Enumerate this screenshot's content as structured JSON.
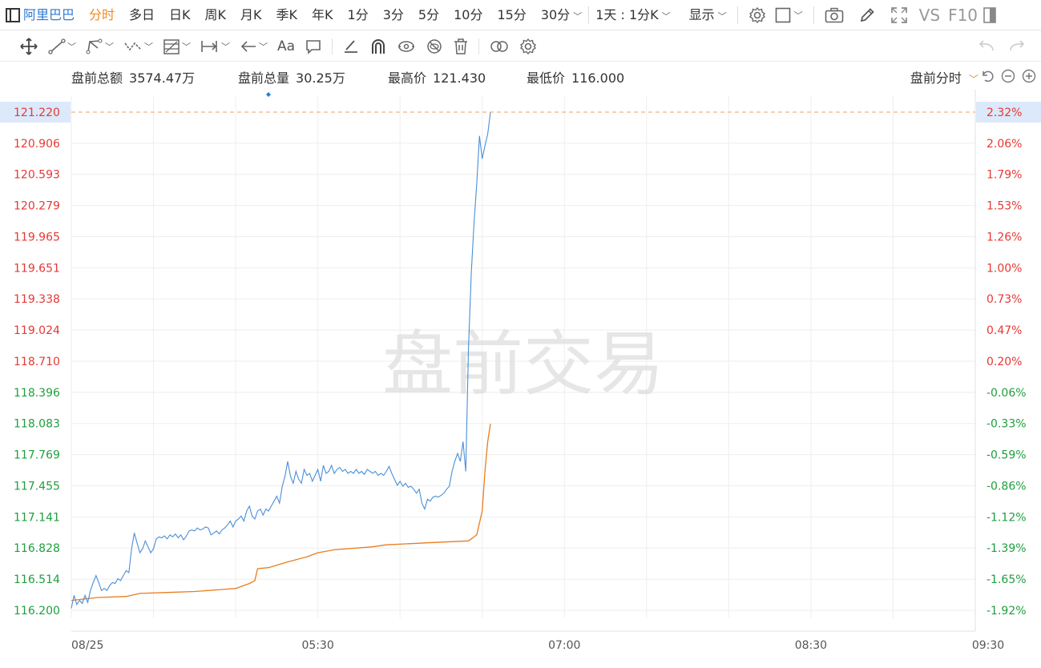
{
  "toolbar": {
    "title": "阿里巴巴",
    "periods": [
      {
        "label": "分时",
        "active": true
      },
      {
        "label": "多日",
        "active": false
      },
      {
        "label": "日K",
        "active": false
      },
      {
        "label": "周K",
        "active": false
      },
      {
        "label": "月K",
        "active": false
      },
      {
        "label": "季K",
        "active": false
      },
      {
        "label": "年K",
        "active": false
      },
      {
        "label": "1分",
        "active": false
      },
      {
        "label": "3分",
        "active": false
      },
      {
        "label": "5分",
        "active": false
      },
      {
        "label": "10分",
        "active": false
      },
      {
        "label": "15分",
        "active": false
      }
    ],
    "period_more": "30分",
    "period_ratio": "1天 : 1分K",
    "display": "显示",
    "vs": "VS",
    "f10": "F10",
    "icons": [
      "panel-toggle-icon",
      "settings-icon",
      "square-icon",
      "camera-icon",
      "pencil-icon",
      "fullscreen-icon"
    ]
  },
  "drawbar": {
    "text_tool": "Aa",
    "icons": [
      "move-icon",
      "line-icon",
      "polyline-icon",
      "wave-icon",
      "fib-icon",
      "measure-icon",
      "arrow-icon",
      "text-icon",
      "comment-icon",
      "eraser-line-icon",
      "magnet-icon",
      "eye-icon",
      "hide-icon",
      "trash-icon",
      "link-icon",
      "settings-icon",
      "undo-icon",
      "redo-icon"
    ]
  },
  "info": {
    "amount_label": "盘前总额",
    "amount_value": "3574.47万",
    "volume_label": "盘前总量",
    "volume_value": "30.25万",
    "high_label": "最高价",
    "high_value": "121.430",
    "low_label": "最低价",
    "low_value": "116.000",
    "mode_label": "盘前分时"
  },
  "colors": {
    "up": "#e53935",
    "down": "#1f9e3f",
    "price_line": "#4a8fd8",
    "avg_line": "#e87d1e",
    "grid": "#eeeeee",
    "highlight_bg": "#dbe9fb",
    "dashed": "#f0a060"
  },
  "chart_data": {
    "type": "line",
    "watermark": "盘前交易",
    "prev_close": 118.5,
    "ylim": [
      116.2,
      121.22
    ],
    "current_price": "121.220",
    "current_pct": "2.32%",
    "y_ticks": [
      121.22,
      120.906,
      120.593,
      120.279,
      119.965,
      119.651,
      119.338,
      119.024,
      118.71,
      118.396,
      118.083,
      117.769,
      117.455,
      117.141,
      116.828,
      116.514,
      116.2
    ],
    "y_tick_labels": [
      "121.220",
      "120.906",
      "120.593",
      "120.279",
      "119.965",
      "119.651",
      "119.338",
      "119.024",
      "118.710",
      "118.396",
      "118.083",
      "117.769",
      "117.455",
      "117.141",
      "116.828",
      "116.514",
      "116.200"
    ],
    "pct_labels": [
      "2.32%",
      "2.06%",
      "1.79%",
      "1.53%",
      "1.26%",
      "1.00%",
      "0.73%",
      "0.47%",
      "0.20%",
      "-0.06%",
      "-0.33%",
      "-0.59%",
      "-0.86%",
      "-1.12%",
      "-1.39%",
      "-1.65%",
      "-1.92%"
    ],
    "x_labels": [
      {
        "t": 0,
        "label": "08/25"
      },
      {
        "t": 90,
        "label": "05:30"
      },
      {
        "t": 180,
        "label": "07:00"
      },
      {
        "t": 270,
        "label": "08:30"
      },
      {
        "t": 330,
        "label": "09:30"
      }
    ],
    "x_range": [
      0,
      330
    ],
    "series": [
      {
        "role": "price",
        "points": [
          [
            0,
            116.22
          ],
          [
            1,
            116.35
          ],
          [
            2,
            116.26
          ],
          [
            3,
            116.3
          ],
          [
            4,
            116.27
          ],
          [
            5,
            116.35
          ],
          [
            6,
            116.28
          ],
          [
            7,
            116.4
          ],
          [
            8,
            116.48
          ],
          [
            9,
            116.55
          ],
          [
            10,
            116.48
          ],
          [
            11,
            116.4
          ],
          [
            12,
            116.42
          ],
          [
            13,
            116.4
          ],
          [
            14,
            116.45
          ],
          [
            15,
            116.48
          ],
          [
            16,
            116.47
          ],
          [
            17,
            116.52
          ],
          [
            18,
            116.5
          ],
          [
            19,
            116.55
          ],
          [
            20,
            116.6
          ],
          [
            21,
            116.58
          ],
          [
            22,
            116.82
          ],
          [
            23,
            116.98
          ],
          [
            24,
            116.88
          ],
          [
            25,
            116.78
          ],
          [
            26,
            116.82
          ],
          [
            27,
            116.9
          ],
          [
            28,
            116.84
          ],
          [
            29,
            116.78
          ],
          [
            30,
            116.82
          ],
          [
            31,
            116.92
          ],
          [
            32,
            116.94
          ],
          [
            33,
            116.93
          ],
          [
            34,
            116.95
          ],
          [
            35,
            116.92
          ],
          [
            36,
            116.96
          ],
          [
            37,
            116.94
          ],
          [
            38,
            116.97
          ],
          [
            39,
            116.93
          ],
          [
            40,
            116.96
          ],
          [
            41,
            116.91
          ],
          [
            42,
            116.95
          ],
          [
            43,
            117.0
          ],
          [
            44,
            117.01
          ],
          [
            45,
            117.0
          ],
          [
            46,
            117.03
          ],
          [
            47,
            117.01
          ],
          [
            48,
            117.02
          ],
          [
            49,
            117.04
          ],
          [
            50,
            117.03
          ],
          [
            51,
            116.96
          ],
          [
            52,
            116.98
          ],
          [
            53,
            117.0
          ],
          [
            54,
            116.97
          ],
          [
            55,
            117.01
          ],
          [
            56,
            117.03
          ],
          [
            57,
            117.06
          ],
          [
            58,
            117.1
          ],
          [
            59,
            117.04
          ],
          [
            60,
            117.1
          ],
          [
            61,
            117.12
          ],
          [
            62,
            117.15
          ],
          [
            63,
            117.1
          ],
          [
            64,
            117.2
          ],
          [
            65,
            117.25
          ],
          [
            66,
            117.15
          ],
          [
            67,
            117.12
          ],
          [
            68,
            117.2
          ],
          [
            69,
            117.22
          ],
          [
            70,
            117.16
          ],
          [
            71,
            117.22
          ],
          [
            72,
            117.2
          ],
          [
            73,
            117.25
          ],
          [
            74,
            117.3
          ],
          [
            75,
            117.35
          ],
          [
            76,
            117.28
          ],
          [
            77,
            117.45
          ],
          [
            78,
            117.55
          ],
          [
            79,
            117.7
          ],
          [
            80,
            117.55
          ],
          [
            81,
            117.48
          ],
          [
            82,
            117.6
          ],
          [
            83,
            117.52
          ],
          [
            84,
            117.48
          ],
          [
            85,
            117.62
          ],
          [
            86,
            117.56
          ],
          [
            87,
            117.58
          ],
          [
            88,
            117.5
          ],
          [
            89,
            117.56
          ],
          [
            90,
            117.62
          ],
          [
            91,
            117.5
          ],
          [
            92,
            117.66
          ],
          [
            93,
            117.58
          ],
          [
            94,
            117.6
          ],
          [
            95,
            117.66
          ],
          [
            96,
            117.58
          ],
          [
            97,
            117.62
          ],
          [
            98,
            117.64
          ],
          [
            99,
            117.6
          ],
          [
            100,
            117.62
          ],
          [
            101,
            117.58
          ],
          [
            102,
            117.6
          ],
          [
            103,
            117.58
          ],
          [
            104,
            117.62
          ],
          [
            105,
            117.58
          ],
          [
            106,
            117.6
          ],
          [
            107,
            117.57
          ],
          [
            108,
            117.62
          ],
          [
            109,
            117.6
          ],
          [
            110,
            117.58
          ],
          [
            111,
            117.6
          ],
          [
            112,
            117.56
          ],
          [
            113,
            117.58
          ],
          [
            114,
            117.56
          ],
          [
            115,
            117.6
          ],
          [
            116,
            117.65
          ],
          [
            117,
            117.58
          ],
          [
            118,
            117.52
          ],
          [
            119,
            117.46
          ],
          [
            120,
            117.5
          ],
          [
            121,
            117.45
          ],
          [
            122,
            117.48
          ],
          [
            123,
            117.44
          ],
          [
            124,
            117.45
          ],
          [
            125,
            117.42
          ],
          [
            126,
            117.38
          ],
          [
            127,
            117.42
          ],
          [
            128,
            117.28
          ],
          [
            129,
            117.22
          ],
          [
            130,
            117.32
          ],
          [
            131,
            117.3
          ],
          [
            132,
            117.34
          ],
          [
            133,
            117.35
          ],
          [
            134,
            117.34
          ],
          [
            135,
            117.36
          ],
          [
            136,
            117.38
          ],
          [
            137,
            117.42
          ],
          [
            138,
            117.45
          ],
          [
            139,
            117.6
          ],
          [
            140,
            117.7
          ],
          [
            141,
            117.78
          ],
          [
            142,
            117.7
          ],
          [
            143,
            117.9
          ],
          [
            144,
            117.6
          ],
          [
            145,
            118.85
          ],
          [
            146,
            119.6
          ],
          [
            147,
            120.1
          ],
          [
            148,
            120.5
          ],
          [
            149,
            120.98
          ],
          [
            150,
            120.75
          ],
          [
            151,
            120.88
          ],
          [
            152,
            121.0
          ],
          [
            153,
            121.22
          ]
        ]
      },
      {
        "role": "average",
        "points": [
          [
            0,
            116.3
          ],
          [
            10,
            116.33
          ],
          [
            20,
            116.34
          ],
          [
            25,
            116.37
          ],
          [
            35,
            116.38
          ],
          [
            45,
            116.39
          ],
          [
            55,
            116.41
          ],
          [
            60,
            116.42
          ],
          [
            65,
            116.47
          ],
          [
            67,
            116.5
          ],
          [
            68,
            116.62
          ],
          [
            72,
            116.63
          ],
          [
            78,
            116.68
          ],
          [
            86,
            116.74
          ],
          [
            90,
            116.78
          ],
          [
            96,
            116.81
          ],
          [
            110,
            116.84
          ],
          [
            115,
            116.86
          ],
          [
            130,
            116.88
          ],
          [
            145,
            116.9
          ],
          [
            148,
            116.96
          ],
          [
            150,
            117.2
          ],
          [
            151,
            117.6
          ],
          [
            152,
            117.9
          ],
          [
            153,
            118.08
          ]
        ]
      }
    ]
  }
}
